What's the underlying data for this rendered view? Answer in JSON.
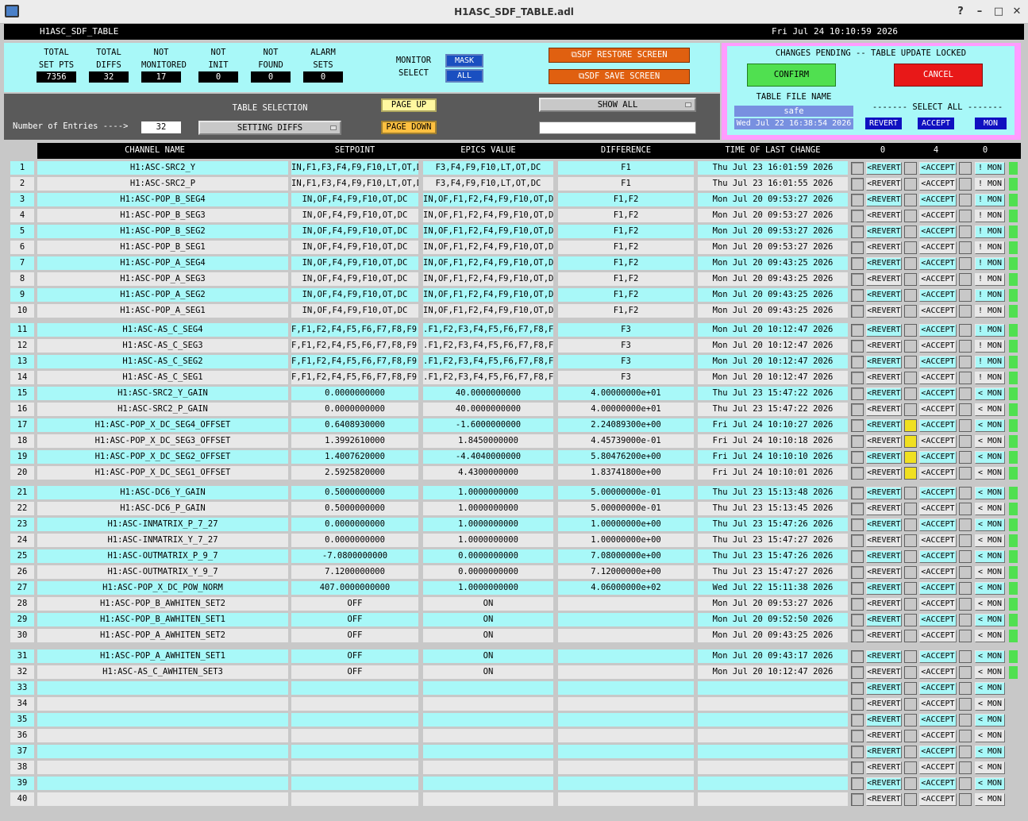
{
  "window": {
    "title": "H1ASC_SDF_TABLE.adl"
  },
  "header": {
    "screen_name": "H1ASC_SDF_TABLE",
    "datetime": "Fri Jul 24 10:10:59 2026"
  },
  "counters": [
    {
      "label1": "TOTAL",
      "label2": "SET PTS",
      "value": "7356"
    },
    {
      "label1": "TOTAL",
      "label2": "DIFFS",
      "value": "32"
    },
    {
      "label1": "NOT",
      "label2": "MONITORED",
      "value": "17"
    },
    {
      "label1": "NOT",
      "label2": "INIT",
      "value": "0"
    },
    {
      "label1": "NOT",
      "label2": "FOUND",
      "value": "0"
    },
    {
      "label1": "ALARM",
      "label2": "SETS",
      "value": "0"
    }
  ],
  "monitor_select": {
    "label1": "MONITOR",
    "label2": "SELECT",
    "mask": "MASK",
    "all": "ALL"
  },
  "actions": {
    "restore": "SDF RESTORE SCREEN",
    "save": "SDF SAVE SCREEN"
  },
  "pending": {
    "title": "CHANGES PENDING -- TABLE UPDATE LOCKED",
    "confirm": "CONFIRM",
    "cancel": "CANCEL",
    "file_label": "TABLE FILE NAME",
    "file_name": "safe",
    "file_time": "Wed Jul 22 16:38:54 2026",
    "select_all": "------- SELECT ALL -------",
    "revert": "REVERT",
    "accept": "ACCEPT",
    "mon": "MON"
  },
  "selection": {
    "entries_label": "Number of Entries ---->",
    "entries_value": "32",
    "table_selection_label": "TABLE SELECTION",
    "table_selection_value": "SETTING DIFFS",
    "page_up": "PAGE UP",
    "page_down": "PAGE DOWN",
    "show_all": "SHOW ALL",
    "filter_value": ""
  },
  "columns": {
    "name": "CHANNEL NAME",
    "setpoint": "SETPOINT",
    "epics": "EPICS VALUE",
    "diff": "DIFFERENCE",
    "time": "TIME OF LAST CHANGE",
    "count_revert": "0",
    "count_accept": "4",
    "count_mon": "0"
  },
  "row_buttons": {
    "revert": "REVERT",
    "accept": "ACCEPT",
    "mon": "MON"
  },
  "colors": {
    "cyan": "#a8f8f8",
    "light": "#e8e8e8",
    "yellow": "#f0e020",
    "green": "#50e050"
  },
  "rows": [
    {
      "n": "1",
      "name": "H1:ASC-SRC2_Y",
      "sp": "IN,F1,F3,F4,F9,F10,LT,OT,DC",
      "ev": "F3,F4,F9,F10,LT,OT,DC",
      "diff": "F1",
      "time": "Thu Jul 23 16:01:59 2026",
      "accept_sel": false,
      "mon": "! MON"
    },
    {
      "n": "2",
      "name": "H1:ASC-SRC2_P",
      "sp": "IN,F1,F3,F4,F9,F10,LT,OT,DC",
      "ev": "F3,F4,F9,F10,LT,OT,DC",
      "diff": "F1",
      "time": "Thu Jul 23 16:01:55 2026",
      "accept_sel": false,
      "mon": "! MON"
    },
    {
      "n": "3",
      "name": "H1:ASC-POP_B_SEG4",
      "sp": "IN,OF,F4,F9,F10,OT,DC",
      "ev": "IN,OF,F1,F2,F4,F9,F10,OT,DC",
      "diff": "F1,F2",
      "time": "Mon Jul 20 09:53:27 2026",
      "accept_sel": false,
      "mon": "! MON"
    },
    {
      "n": "4",
      "name": "H1:ASC-POP_B_SEG3",
      "sp": "IN,OF,F4,F9,F10,OT,DC",
      "ev": "IN,OF,F1,F2,F4,F9,F10,OT,DC",
      "diff": "F1,F2",
      "time": "Mon Jul 20 09:53:27 2026",
      "accept_sel": false,
      "mon": "! MON"
    },
    {
      "n": "5",
      "name": "H1:ASC-POP_B_SEG2",
      "sp": "IN,OF,F4,F9,F10,OT,DC",
      "ev": "IN,OF,F1,F2,F4,F9,F10,OT,DC",
      "diff": "F1,F2",
      "time": "Mon Jul 20 09:53:27 2026",
      "accept_sel": false,
      "mon": "! MON"
    },
    {
      "n": "6",
      "name": "H1:ASC-POP_B_SEG1",
      "sp": "IN,OF,F4,F9,F10,OT,DC",
      "ev": "IN,OF,F1,F2,F4,F9,F10,OT,DC",
      "diff": "F1,F2",
      "time": "Mon Jul 20 09:53:27 2026",
      "accept_sel": false,
      "mon": "! MON"
    },
    {
      "n": "7",
      "name": "H1:ASC-POP_A_SEG4",
      "sp": "IN,OF,F4,F9,F10,OT,DC",
      "ev": "IN,OF,F1,F2,F4,F9,F10,OT,DC",
      "diff": "F1,F2",
      "time": "Mon Jul 20 09:43:25 2026",
      "accept_sel": false,
      "mon": "! MON"
    },
    {
      "n": "8",
      "name": "H1:ASC-POP_A_SEG3",
      "sp": "IN,OF,F4,F9,F10,OT,DC",
      "ev": "IN,OF,F1,F2,F4,F9,F10,OT,DC",
      "diff": "F1,F2",
      "time": "Mon Jul 20 09:43:25 2026",
      "accept_sel": false,
      "mon": "! MON"
    },
    {
      "n": "9",
      "name": "H1:ASC-POP_A_SEG2",
      "sp": "IN,OF,F4,F9,F10,OT,DC",
      "ev": "IN,OF,F1,F2,F4,F9,F10,OT,DC",
      "diff": "F1,F2",
      "time": "Mon Jul 20 09:43:25 2026",
      "accept_sel": false,
      "mon": "! MON"
    },
    {
      "n": "10",
      "name": "H1:ASC-POP_A_SEG1",
      "sp": "IN,OF,F4,F9,F10,OT,DC",
      "ev": "IN,OF,F1,F2,F4,F9,F10,OT,DC",
      "diff": "F1,F2",
      "time": "Mon Jul 20 09:43:25 2026",
      "accept_sel": false,
      "mon": "! MON"
    },
    {
      "n": "11",
      "name": "H1:ASC-AS_C_SEG4",
      "sp": "F,F1,F2,F4,F5,F6,F7,F8,F9,O",
      "ev": ".F1,F2,F3,F4,F5,F6,F7,F8,F9,",
      "diff": "F3",
      "time": "Mon Jul 20 10:12:47 2026",
      "accept_sel": false,
      "mon": "! MON"
    },
    {
      "n": "12",
      "name": "H1:ASC-AS_C_SEG3",
      "sp": "F,F1,F2,F4,F5,F6,F7,F8,F9,O",
      "ev": ".F1,F2,F3,F4,F5,F6,F7,F8,F9,",
      "diff": "F3",
      "time": "Mon Jul 20 10:12:47 2026",
      "accept_sel": false,
      "mon": "! MON"
    },
    {
      "n": "13",
      "name": "H1:ASC-AS_C_SEG2",
      "sp": "F,F1,F2,F4,F5,F6,F7,F8,F9,O",
      "ev": ".F1,F2,F3,F4,F5,F6,F7,F8,F9,",
      "diff": "F3",
      "time": "Mon Jul 20 10:12:47 2026",
      "accept_sel": false,
      "mon": "! MON"
    },
    {
      "n": "14",
      "name": "H1:ASC-AS_C_SEG1",
      "sp": "F,F1,F2,F4,F5,F6,F7,F8,F9,O",
      "ev": ".F1,F2,F3,F4,F5,F6,F7,F8,F9,",
      "diff": "F3",
      "time": "Mon Jul 20 10:12:47 2026",
      "accept_sel": false,
      "mon": "! MON"
    },
    {
      "n": "15",
      "name": "H1:ASC-SRC2_Y_GAIN",
      "sp": "0.0000000000",
      "ev": "40.0000000000",
      "diff": "4.00000000e+01",
      "time": "Thu Jul 23 15:47:22 2026",
      "accept_sel": false,
      "mon": "< MON"
    },
    {
      "n": "16",
      "name": "H1:ASC-SRC2_P_GAIN",
      "sp": "0.0000000000",
      "ev": "40.0000000000",
      "diff": "4.00000000e+01",
      "time": "Thu Jul 23 15:47:22 2026",
      "accept_sel": false,
      "mon": "< MON"
    },
    {
      "n": "17",
      "name": "H1:ASC-POP_X_DC_SEG4_OFFSET",
      "sp": "0.6408930000",
      "ev": "-1.6000000000",
      "diff": "2.24089300e+00",
      "time": "Fri Jul 24 10:10:27 2026",
      "accept_sel": true,
      "mon": "< MON"
    },
    {
      "n": "18",
      "name": "H1:ASC-POP_X_DC_SEG3_OFFSET",
      "sp": "1.3992610000",
      "ev": "1.8450000000",
      "diff": "4.45739000e-01",
      "time": "Fri Jul 24 10:10:18 2026",
      "accept_sel": true,
      "mon": "< MON"
    },
    {
      "n": "19",
      "name": "H1:ASC-POP_X_DC_SEG2_OFFSET",
      "sp": "1.4007620000",
      "ev": "-4.4040000000",
      "diff": "5.80476200e+00",
      "time": "Fri Jul 24 10:10:10 2026",
      "accept_sel": true,
      "mon": "< MON"
    },
    {
      "n": "20",
      "name": "H1:ASC-POP_X_DC_SEG1_OFFSET",
      "sp": "2.5925820000",
      "ev": "4.4300000000",
      "diff": "1.83741800e+00",
      "time": "Fri Jul 24 10:10:01 2026",
      "accept_sel": true,
      "mon": "< MON"
    },
    {
      "n": "21",
      "name": "H1:ASC-DC6_Y_GAIN",
      "sp": "0.5000000000",
      "ev": "1.0000000000",
      "diff": "5.00000000e-01",
      "time": "Thu Jul 23 15:13:48 2026",
      "accept_sel": false,
      "mon": "< MON"
    },
    {
      "n": "22",
      "name": "H1:ASC-DC6_P_GAIN",
      "sp": "0.5000000000",
      "ev": "1.0000000000",
      "diff": "5.00000000e-01",
      "time": "Thu Jul 23 15:13:45 2026",
      "accept_sel": false,
      "mon": "< MON"
    },
    {
      "n": "23",
      "name": "H1:ASC-INMATRIX_P_7_27",
      "sp": "0.0000000000",
      "ev": "1.0000000000",
      "diff": "1.00000000e+00",
      "time": "Thu Jul 23 15:47:26 2026",
      "accept_sel": false,
      "mon": "< MON"
    },
    {
      "n": "24",
      "name": "H1:ASC-INMATRIX_Y_7_27",
      "sp": "0.0000000000",
      "ev": "1.0000000000",
      "diff": "1.00000000e+00",
      "time": "Thu Jul 23 15:47:27 2026",
      "accept_sel": false,
      "mon": "< MON"
    },
    {
      "n": "25",
      "name": "H1:ASC-OUTMATRIX_P_9_7",
      "sp": "-7.0800000000",
      "ev": "0.0000000000",
      "diff": "7.08000000e+00",
      "time": "Thu Jul 23 15:47:26 2026",
      "accept_sel": false,
      "mon": "< MON"
    },
    {
      "n": "26",
      "name": "H1:ASC-OUTMATRIX_Y_9_7",
      "sp": "7.1200000000",
      "ev": "0.0000000000",
      "diff": "7.12000000e+00",
      "time": "Thu Jul 23 15:47:27 2026",
      "accept_sel": false,
      "mon": "< MON"
    },
    {
      "n": "27",
      "name": "H1:ASC-POP_X_DC_POW_NORM",
      "sp": "407.0000000000",
      "ev": "1.0000000000",
      "diff": "4.06000000e+02",
      "time": "Wed Jul 22 15:11:38 2026",
      "accept_sel": false,
      "mon": "< MON"
    },
    {
      "n": "28",
      "name": "H1:ASC-POP_B_AWHITEN_SET2",
      "sp": "OFF",
      "ev": "ON",
      "diff": "",
      "time": "Mon Jul 20 09:53:27 2026",
      "accept_sel": false,
      "mon": "< MON"
    },
    {
      "n": "29",
      "name": "H1:ASC-POP_B_AWHITEN_SET1",
      "sp": "OFF",
      "ev": "ON",
      "diff": "",
      "time": "Mon Jul 20 09:52:50 2026",
      "accept_sel": false,
      "mon": "< MON"
    },
    {
      "n": "30",
      "name": "H1:ASC-POP_A_AWHITEN_SET2",
      "sp": "OFF",
      "ev": "ON",
      "diff": "",
      "time": "Mon Jul 20 09:43:25 2026",
      "accept_sel": false,
      "mon": "< MON"
    },
    {
      "n": "31",
      "name": "H1:ASC-POP_A_AWHITEN_SET1",
      "sp": "OFF",
      "ev": "ON",
      "diff": "",
      "time": "Mon Jul 20 09:43:17 2026",
      "accept_sel": false,
      "mon": "< MON"
    },
    {
      "n": "32",
      "name": "H1:ASC-AS_C_AWHITEN_SET3",
      "sp": "OFF",
      "ev": "ON",
      "diff": "",
      "time": "Mon Jul 20 10:12:47 2026",
      "accept_sel": false,
      "mon": "< MON"
    },
    {
      "n": "33",
      "name": "",
      "sp": "",
      "ev": "",
      "diff": "",
      "time": "",
      "accept_sel": false,
      "mon": "< MON"
    },
    {
      "n": "34",
      "name": "",
      "sp": "",
      "ev": "",
      "diff": "",
      "time": "",
      "accept_sel": false,
      "mon": "< MON"
    },
    {
      "n": "35",
      "name": "",
      "sp": "",
      "ev": "",
      "diff": "",
      "time": "",
      "accept_sel": false,
      "mon": "< MON"
    },
    {
      "n": "36",
      "name": "",
      "sp": "",
      "ev": "",
      "diff": "",
      "time": "",
      "accept_sel": false,
      "mon": "< MON"
    },
    {
      "n": "37",
      "name": "",
      "sp": "",
      "ev": "",
      "diff": "",
      "time": "",
      "accept_sel": false,
      "mon": "< MON"
    },
    {
      "n": "38",
      "name": "",
      "sp": "",
      "ev": "",
      "diff": "",
      "time": "",
      "accept_sel": false,
      "mon": "< MON"
    },
    {
      "n": "39",
      "name": "",
      "sp": "",
      "ev": "",
      "diff": "",
      "time": "",
      "accept_sel": false,
      "mon": "< MON"
    },
    {
      "n": "40",
      "name": "",
      "sp": "",
      "ev": "",
      "diff": "",
      "time": "",
      "accept_sel": false,
      "mon": "< MON"
    }
  ]
}
